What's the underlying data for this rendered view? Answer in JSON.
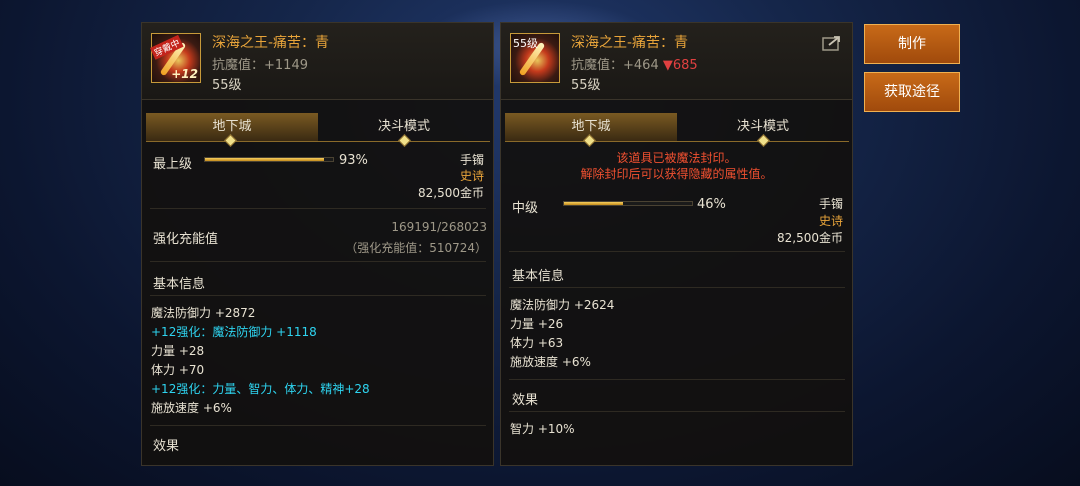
{
  "left": {
    "item_name": "深海之王-痛苦：青",
    "icon_badge": "穿戴中",
    "icon_plus": "+12",
    "resist_label": "抗魔值：",
    "resist_value": "+1149",
    "level": "55级",
    "tabs": [
      "地下城",
      "决斗模式"
    ],
    "grade": "最上级",
    "grade_percent": "93%",
    "grade_fill": 0.93,
    "type": "手镯",
    "rarity": "史诗",
    "price": "82,500金币",
    "charge_label": "强化充能值",
    "charge_value": "169191/268023",
    "charge_sub": "（强化充能值：510724）",
    "basic_info_title": "基本信息",
    "stats": [
      {
        "text": "魔法防御力 +2872",
        "color": "white"
      },
      {
        "text": "+12强化：魔法防御力 +1118",
        "color": "cyan"
      },
      {
        "text": "力量 +28",
        "color": "white"
      },
      {
        "text": "体力 +70",
        "color": "white"
      },
      {
        "text": "+12强化：力量、智力、体力、精神+28",
        "color": "cyan"
      },
      {
        "text": "施放速度 +6%",
        "color": "white"
      }
    ],
    "effect_title": "效果"
  },
  "right": {
    "item_name": "深海之王-痛苦：青",
    "icon_level": "55级",
    "resist_label": "抗魔值：",
    "resist_value": "+464",
    "resist_diff": "▼685",
    "level": "55级",
    "tabs": [
      "地下城",
      "决斗模式"
    ],
    "sealed_line1": "该道具已被魔法封印。",
    "sealed_line2": "解除封印后可以获得隐藏的属性值。",
    "grade": "中级",
    "grade_percent": "46%",
    "grade_fill": 0.46,
    "type": "手镯",
    "rarity": "史诗",
    "price": "82,500金币",
    "basic_info_title": "基本信息",
    "stats": [
      {
        "text": "魔法防御力 +2624"
      },
      {
        "text": "力量 +26"
      },
      {
        "text": "体力 +63"
      },
      {
        "text": "施放速度 +6%"
      }
    ],
    "effect_title": "效果",
    "effect_stats": [
      {
        "text": "智力 +10%"
      }
    ]
  },
  "buttons": {
    "make": "制作",
    "obtain": "获取途径"
  },
  "icons": [
    "share-icon"
  ]
}
